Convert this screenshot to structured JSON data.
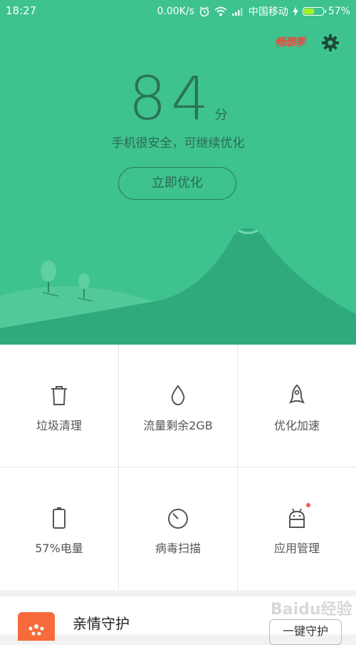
{
  "status_bar": {
    "time": "18:27",
    "speed": "0.00K/s",
    "carrier": "中国移动",
    "battery": "57%",
    "battery_level": 0.57
  },
  "header": {
    "brand_logo": "畅想季"
  },
  "score": {
    "value": "84",
    "unit": "分",
    "message": "手机很安全，可继续优化",
    "button": "立即优化"
  },
  "tools": [
    {
      "label": "垃圾清理",
      "icon": "trash-icon"
    },
    {
      "label": "流量剩余2GB",
      "icon": "drop-icon"
    },
    {
      "label": "优化加速",
      "icon": "rocket-icon"
    },
    {
      "label": "57%电量",
      "icon": "battery-icon"
    },
    {
      "label": "病毒扫描",
      "icon": "scan-icon"
    },
    {
      "label": "应用管理",
      "icon": "android-icon"
    }
  ],
  "family": {
    "title": "亲情守护",
    "button": "一键守护"
  },
  "watermark": "Baidu经验",
  "colors": {
    "hero": "#3ec28e",
    "accent_red": "#e94a3f",
    "badge": "#f25b47"
  }
}
